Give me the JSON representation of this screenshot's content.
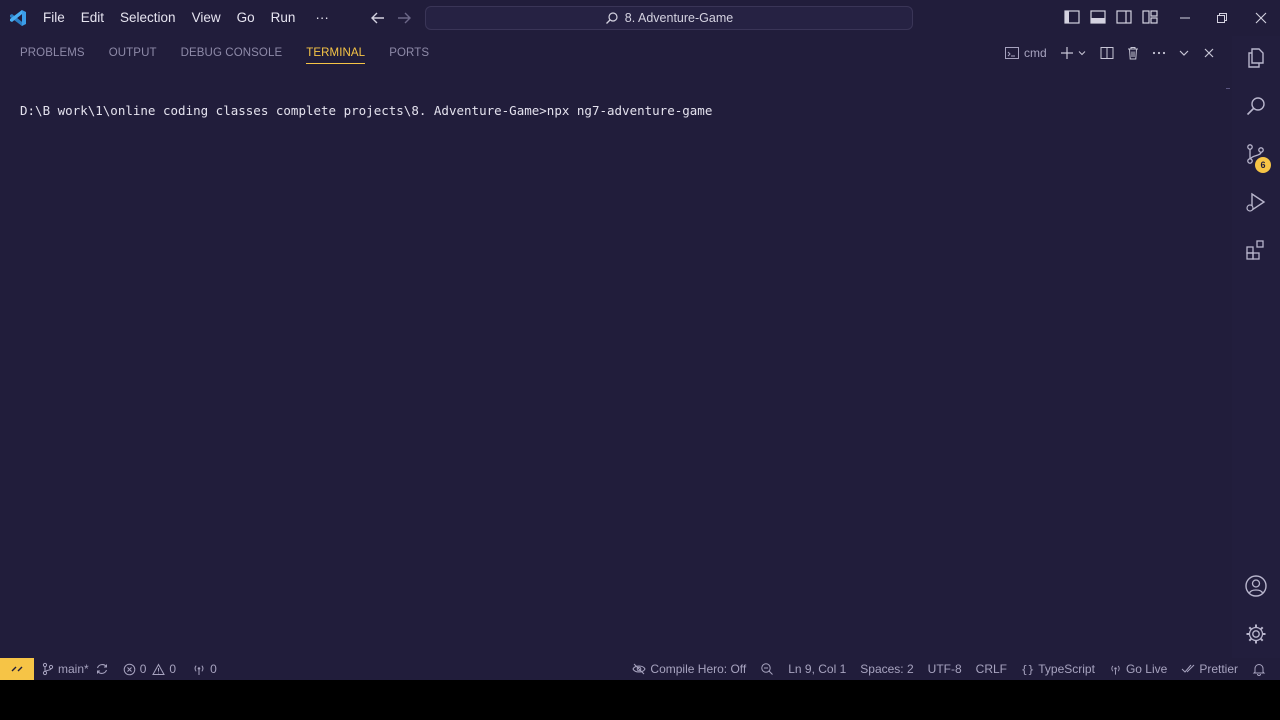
{
  "titlebar": {
    "menu": [
      "File",
      "Edit",
      "Selection",
      "View",
      "Go",
      "Run",
      "···"
    ],
    "search_text": "8. Adventure-Game"
  },
  "panel": {
    "tabs": [
      "PROBLEMS",
      "OUTPUT",
      "DEBUG CONSOLE",
      "TERMINAL",
      "PORTS"
    ],
    "active_tab": "TERMINAL",
    "terminal_name": "cmd"
  },
  "terminal": {
    "line": "D:\\B work\\1\\online coding classes complete projects\\8. Adventure-Game>npx ng7-adventure-game"
  },
  "activitybar": {
    "source_control_badge": "6"
  },
  "statusbar": {
    "branch": "main*",
    "errors": "0",
    "warnings": "0",
    "ports": "0",
    "compile_hero": "Compile Hero: Off",
    "position": "Ln 9, Col 1",
    "spaces": "Spaces: 2",
    "encoding": "UTF-8",
    "eol": "CRLF",
    "language": "TypeScript",
    "go_live": "Go Live",
    "prettier": "Prettier"
  },
  "colors": {
    "background": "#211d3b",
    "accent": "#f6c446",
    "vscode_blue": "#3b9de8"
  },
  "icons": [
    "vscode-logo-icon",
    "arrow-left-icon",
    "arrow-right-icon",
    "search-icon",
    "layout-sidebar-left-icon",
    "layout-panel-icon",
    "layout-sidebar-right-icon",
    "customize-layout-icon",
    "minimize-icon",
    "restore-icon",
    "close-icon",
    "terminal-icon",
    "plus-icon",
    "chevron-down-icon",
    "split-icon",
    "trash-icon",
    "ellipsis-icon",
    "explorer-icon",
    "source-control-icon",
    "run-debug-icon",
    "extensions-icon",
    "account-icon",
    "gear-icon",
    "remote-icon",
    "branch-icon",
    "sync-icon",
    "error-icon",
    "warning-icon",
    "broadcast-icon",
    "bell-icon"
  ]
}
